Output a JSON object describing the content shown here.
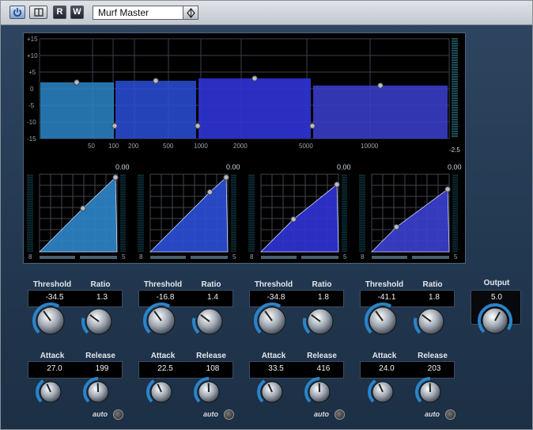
{
  "header": {
    "power_icon": "power-icon",
    "bypass_icon": "bypass-icon",
    "read_label": "R",
    "write_label": "W",
    "preset_name": "Murf Master"
  },
  "display": {
    "gain_scale": [
      "+15",
      "+10",
      "+5",
      "0",
      "-5",
      "-10",
      "-15"
    ],
    "freq_labels": [
      "50",
      "100",
      "200",
      "500",
      "1000",
      "2000",
      "5000",
      "10000"
    ],
    "right_meter_value": "-2.5",
    "band_gain_values": [
      "0.00",
      "0.00",
      "0.00",
      "0.00"
    ],
    "band_colors": [
      "#2c86c9",
      "#2b4fd8",
      "#2f33d6",
      "#3b3fd0"
    ],
    "curve_scale_left": "8",
    "curve_scale_right": "5"
  },
  "bands": [
    {
      "threshold_label": "Threshold",
      "ratio_label": "Ratio",
      "threshold": "-34.5",
      "ratio": "1.3",
      "attack_label": "Attack",
      "release_label": "Release",
      "attack": "27.0",
      "release": "199",
      "auto_label": "auto"
    },
    {
      "threshold_label": "Threshold",
      "ratio_label": "Ratio",
      "threshold": "-16.8",
      "ratio": "1.4",
      "attack_label": "Attack",
      "release_label": "Release",
      "attack": "22.5",
      "release": "108",
      "auto_label": "auto"
    },
    {
      "threshold_label": "Threshold",
      "ratio_label": "Ratio",
      "threshold": "-34.8",
      "ratio": "1.8",
      "attack_label": "Attack",
      "release_label": "Release",
      "attack": "33.5",
      "release": "416",
      "auto_label": "auto"
    },
    {
      "threshold_label": "Threshold",
      "ratio_label": "Ratio",
      "threshold": "-41.1",
      "ratio": "1.8",
      "attack_label": "Attack",
      "release_label": "Release",
      "attack": "24.0",
      "release": "203",
      "auto_label": "auto"
    }
  ],
  "output": {
    "label": "Output",
    "value": "5.0"
  }
}
